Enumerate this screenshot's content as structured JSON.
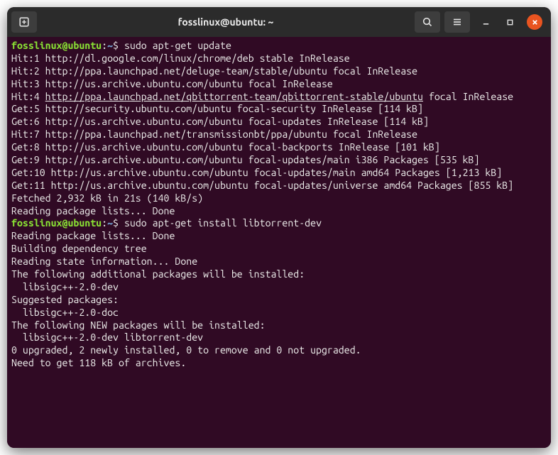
{
  "titlebar": {
    "title": "fosslinux@ubuntu: ~"
  },
  "prompt": {
    "user_host": "fosslinux@ubuntu",
    "sep": ":",
    "path": "~",
    "marker": "$"
  },
  "session": {
    "cmd1": "sudo apt-get update",
    "out1": [
      "Hit:1 http://dl.google.com/linux/chrome/deb stable InRelease",
      "Hit:2 http://ppa.launchpad.net/deluge-team/stable/ubuntu focal InRelease",
      "Hit:3 http://us.archive.ubuntu.com/ubuntu focal InRelease"
    ],
    "hit4_prefix": "Hit:4 ",
    "hit4_url": "http://ppa.launchpad.net/qbittorrent-team/qbittorrent-stable/ubuntu",
    "hit4_suffix": " focal InRelease",
    "out1b": [
      "Get:5 http://security.ubuntu.com/ubuntu focal-security InRelease [114 kB]",
      "Get:6 http://us.archive.ubuntu.com/ubuntu focal-updates InRelease [114 kB]",
      "Hit:7 http://ppa.launchpad.net/transmissionbt/ppa/ubuntu focal InRelease",
      "Get:8 http://us.archive.ubuntu.com/ubuntu focal-backports InRelease [101 kB]",
      "Get:9 http://us.archive.ubuntu.com/ubuntu focal-updates/main i386 Packages [535 kB]",
      "Get:10 http://us.archive.ubuntu.com/ubuntu focal-updates/main amd64 Packages [1,213 kB]",
      "Get:11 http://us.archive.ubuntu.com/ubuntu focal-updates/universe amd64 Packages [855 kB]",
      "Fetched 2,932 kB in 21s (140 kB/s)",
      "Reading package lists... Done"
    ],
    "cmd2": "sudo apt-get install libtorrent-dev",
    "out2": [
      "Reading package lists... Done",
      "Building dependency tree",
      "Reading state information... Done",
      "The following additional packages will be installed:",
      "  libsigc++-2.0-dev",
      "Suggested packages:",
      "  libsigc++-2.0-doc",
      "The following NEW packages will be installed:",
      "  libsigc++-2.0-dev libtorrent-dev",
      "0 upgraded, 2 newly installed, 0 to remove and 0 not upgraded.",
      "Need to get 118 kB of archives."
    ]
  }
}
